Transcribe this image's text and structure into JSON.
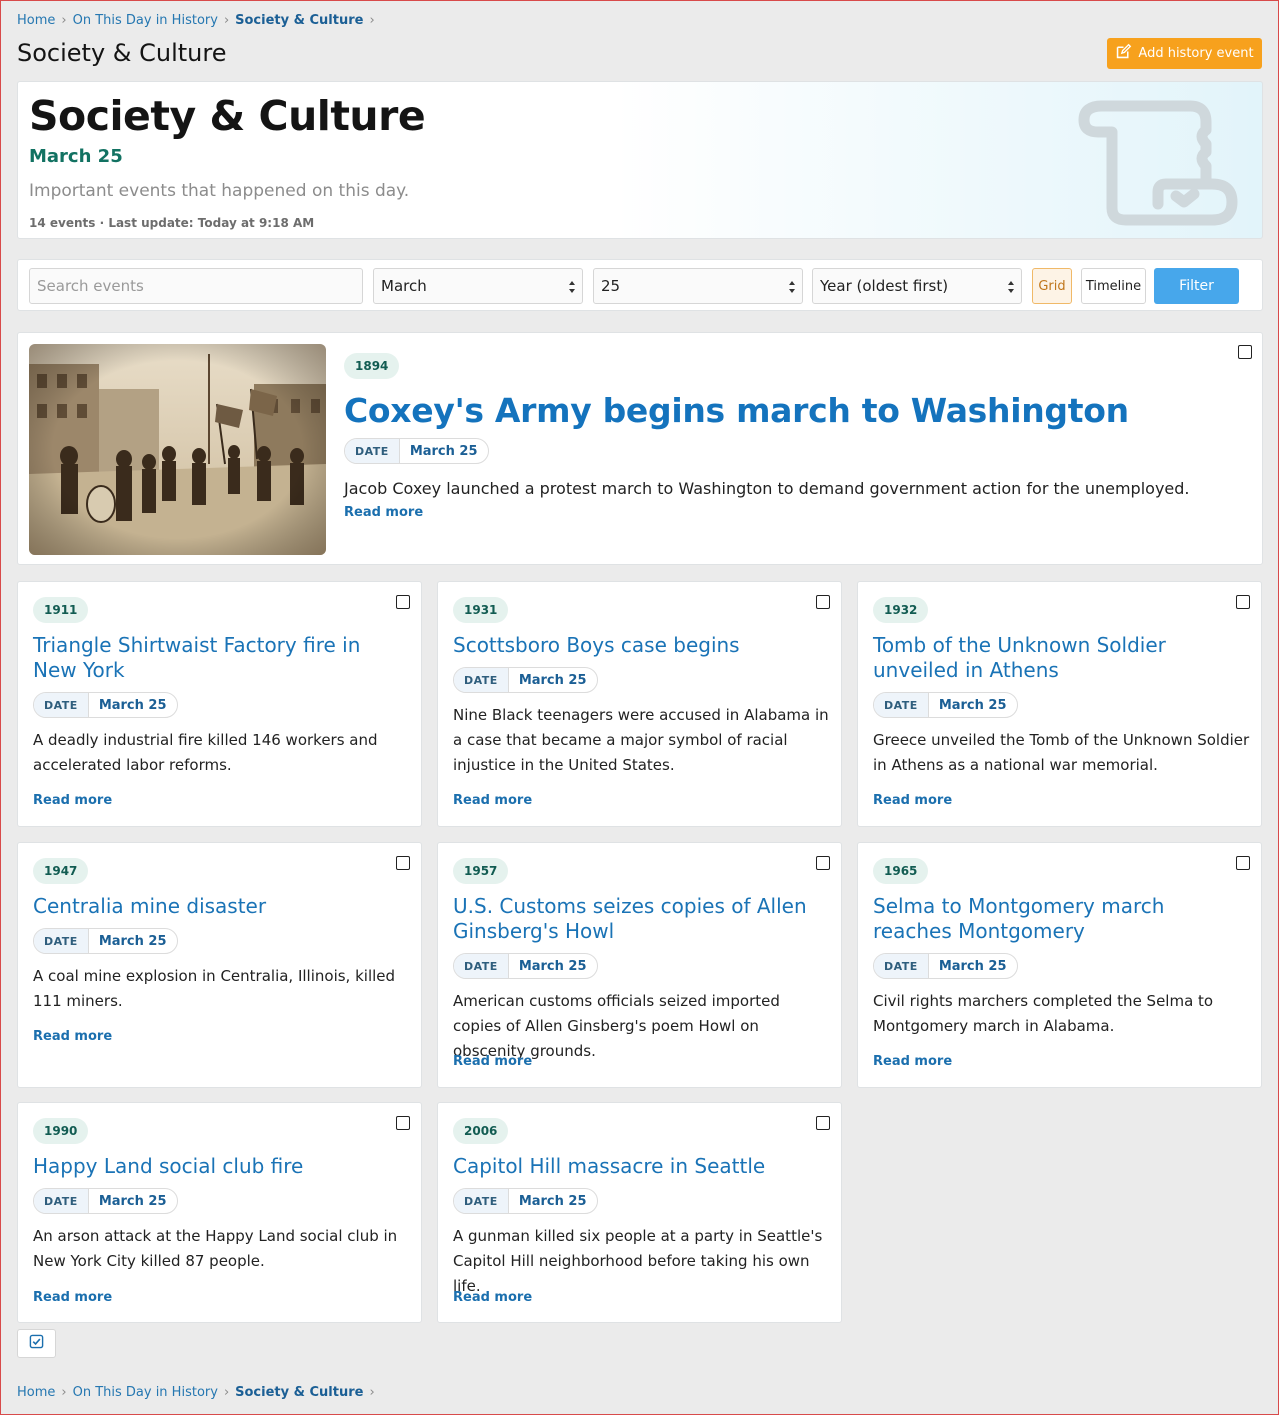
{
  "breadcrumb": {
    "home": "Home",
    "section": "On This Day in History",
    "current": "Society & Culture",
    "separator": "›"
  },
  "page_title": "Society & Culture",
  "add_button": {
    "label": "Add history event",
    "icon": "edit-icon",
    "color": "#f7a11d"
  },
  "hero": {
    "title": "Society & Culture",
    "date": "March 25",
    "description": "Important events that happened on this day.",
    "meta": "14 events · Last update: Today at 9:18 AM",
    "icon": "scroll-icon"
  },
  "filter": {
    "search_placeholder": "Search events",
    "month": "March",
    "day": "25",
    "sort": "Year (oldest first)",
    "view_grid": "Grid",
    "view_timeline": "Timeline",
    "active_view": "Grid",
    "submit": "Filter",
    "accent": "#47a7eb"
  },
  "date_label": "DATE",
  "read_more": "Read more",
  "featured": {
    "year": "1894",
    "title": "Coxey's Army begins march to Washington",
    "date": "March 25",
    "summary": "Jacob Coxey launched a protest march to Washington to demand government action for the unemployed."
  },
  "events": [
    {
      "year": "1911",
      "title": "Triangle Shirtwaist Factory fire in New York",
      "date": "March 25",
      "summary": "A deadly industrial fire killed 146 workers and accelerated labor reforms."
    },
    {
      "year": "1931",
      "title": "Scottsboro Boys case begins",
      "date": "March 25",
      "summary": "Nine Black teenagers were accused in Alabama in a case that became a major symbol of racial injustice in the United States."
    },
    {
      "year": "1932",
      "title": "Tomb of the Unknown Soldier unveiled in Athens",
      "date": "March 25",
      "summary": "Greece unveiled the Tomb of the Unknown Soldier in Athens as a national war memorial."
    },
    {
      "year": "1947",
      "title": "Centralia mine disaster",
      "date": "March 25",
      "summary": "A coal mine explosion in Centralia, Illinois, killed 111 miners."
    },
    {
      "year": "1957",
      "title": "U.S. Customs seizes copies of Allen Ginsberg's Howl",
      "date": "March 25",
      "summary": "American customs officials seized imported copies of Allen Ginsberg's poem Howl on obscenity grounds."
    },
    {
      "year": "1965",
      "title": "Selma to Montgomery march reaches Montgomery",
      "date": "March 25",
      "summary": "Civil rights marchers completed the Selma to Montgomery march in Alabama."
    },
    {
      "year": "1990",
      "title": "Happy Land social club fire",
      "date": "March 25",
      "summary": "An arson attack at the Happy Land social club in New York City killed 87 people."
    },
    {
      "year": "2006",
      "title": "Capitol Hill massacre in Seattle",
      "date": "March 25",
      "summary": "A gunman killed six people at a party in Seattle's Capitol Hill neighborhood before taking his own life."
    }
  ]
}
